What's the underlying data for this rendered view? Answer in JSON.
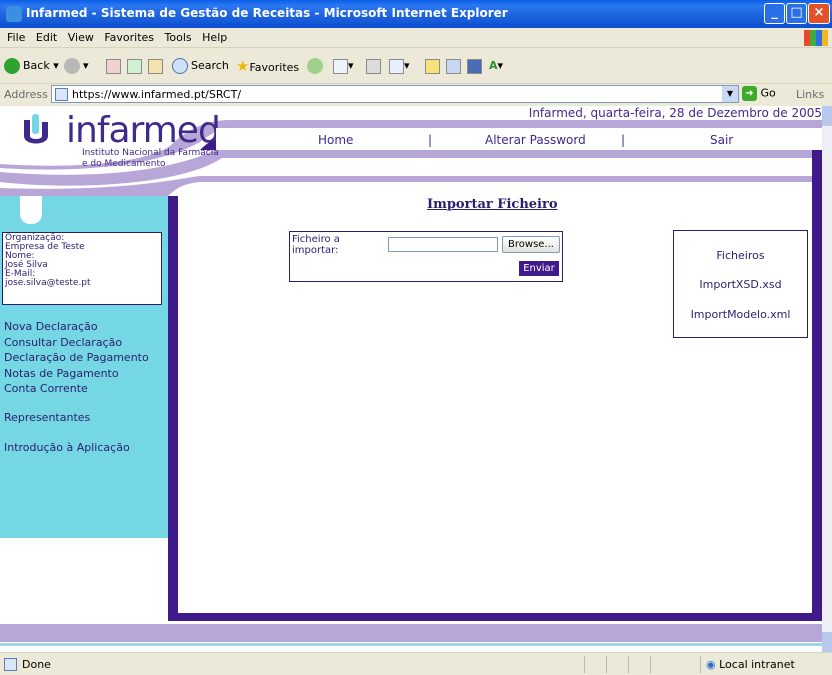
{
  "window": {
    "title": "Infarmed - Sistema de Gestão de Receitas - Microsoft Internet Explorer"
  },
  "menubar": [
    "File",
    "Edit",
    "View",
    "Favorites",
    "Tools",
    "Help"
  ],
  "toolbar": {
    "back": "Back",
    "search": "Search",
    "favorites": "Favorites"
  },
  "address": {
    "label": "Address",
    "url": "https://www.infarmed.pt/SRCT/",
    "go": "Go",
    "links": "Links"
  },
  "page": {
    "date": "Infarmed, quarta-feira, 28 de Dezembro de 2005",
    "logo": {
      "word": "infarmed",
      "sub1": "Instituto Nacional da Farmácia",
      "sub2": "e do Medicamento"
    },
    "nav": {
      "home": "Home",
      "sep": "|",
      "password": "Alterar Password",
      "exit": "Sair"
    },
    "user": {
      "org_label": "Organização:",
      "org": "Empresa de Teste",
      "name_label": "Nome:",
      "name": "José Silva",
      "email_label": "E-Mail:",
      "email": "jose.silva@teste.pt"
    },
    "menu": [
      "Nova Declaração",
      "Consultar Declaração",
      "Declaração de Pagamento",
      "Notas de Pagamento",
      "Conta Corrente",
      "Representantes",
      "Introdução à Aplicação"
    ],
    "title": "Importar Ficheiro",
    "form": {
      "label": "Ficheiro a importar:",
      "browse": "Browse...",
      "submit": "Enviar"
    },
    "files": {
      "title": "Ficheiros",
      "items": [
        "ImportXSD.xsd",
        "ImportModelo.xml"
      ]
    }
  },
  "status": {
    "text": "Done",
    "zone": "Local intranet"
  }
}
